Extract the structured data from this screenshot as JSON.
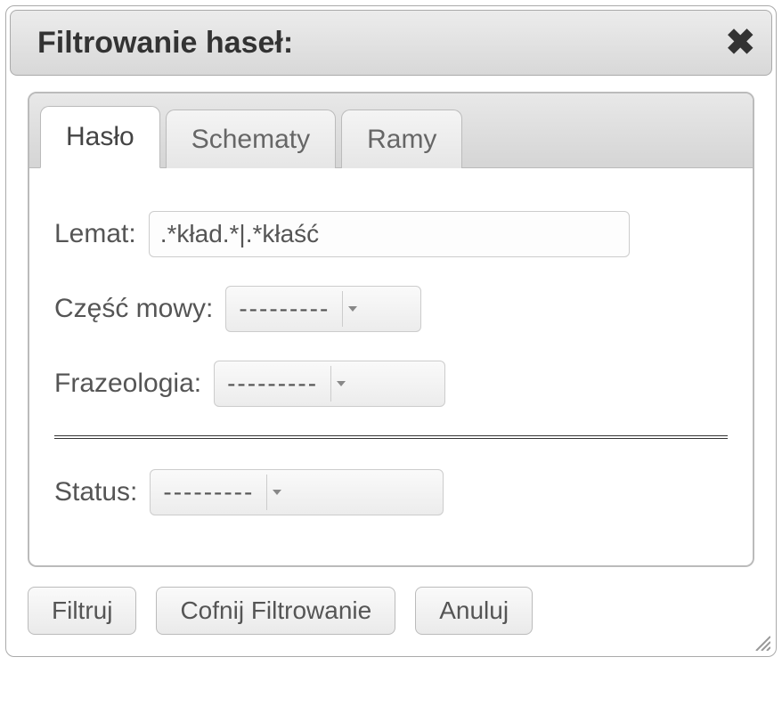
{
  "dialog": {
    "title": "Filtrowanie haseł:",
    "close_glyph": "✖"
  },
  "tabs": {
    "t0": "Hasło",
    "t1": "Schematy",
    "t2": "Ramy"
  },
  "fields": {
    "lemat_label": "Lemat:",
    "lemat_value": ".*kład.*|.*kłaść",
    "pos_label": "Część mowy:",
    "pos_value": "---------",
    "fraz_label": "Frazeologia:",
    "fraz_value": "---------",
    "status_label": "Status:",
    "status_value": "---------"
  },
  "buttons": {
    "filter": "Filtruj",
    "undo": "Cofnij Filtrowanie",
    "cancel": "Anuluj"
  }
}
